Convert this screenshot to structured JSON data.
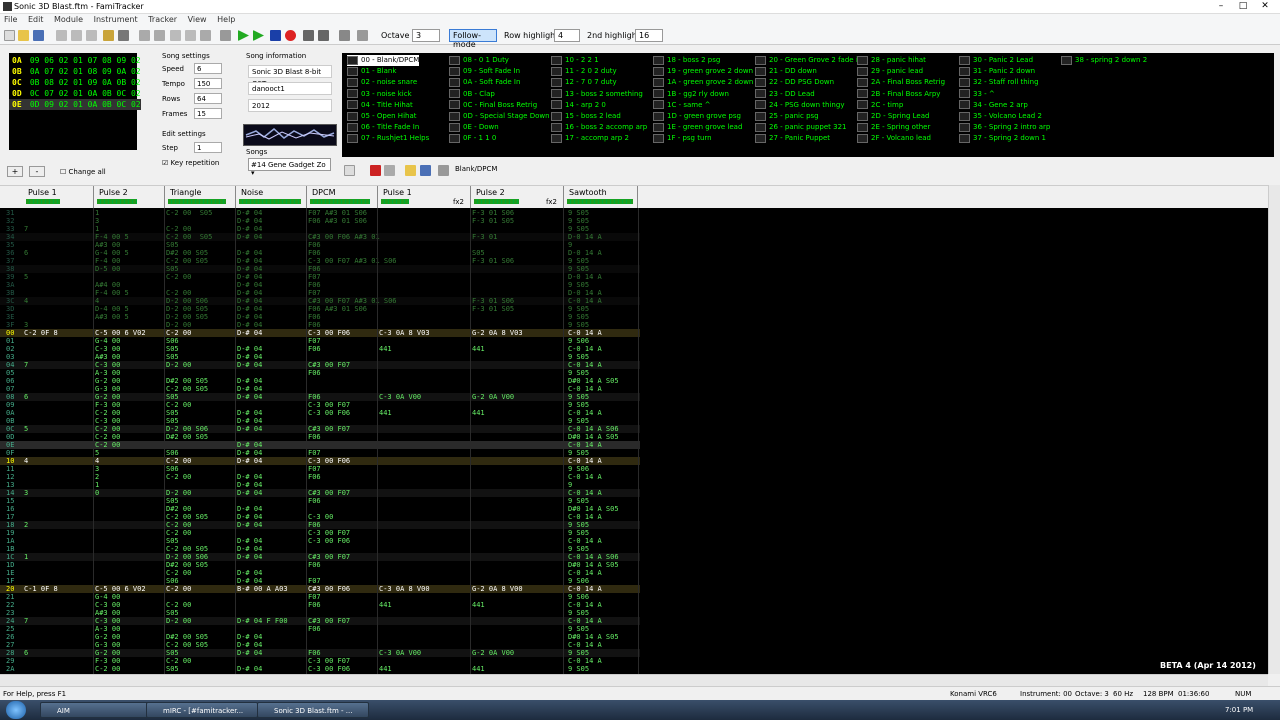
{
  "window": {
    "title": "Sonic 3D Blast.ftm - FamiTracker"
  },
  "menu": [
    "File",
    "Edit",
    "Module",
    "Instrument",
    "Tracker",
    "View",
    "Help"
  ],
  "toolbar": {
    "octave_label": "Octave",
    "octave_value": "3",
    "follow_mode": "Follow-mode",
    "row_highlight_label": "Row highlight",
    "row_highlight_value": "4",
    "second_highlight_label": "2nd highlight",
    "second_highlight_value": "16"
  },
  "frames": [
    {
      "row": "0A",
      "values": "09 06 02 01 07 08 09 02"
    },
    {
      "row": "0B",
      "values": "0A 07 02 01 08 09 0A 02"
    },
    {
      "row": "0C",
      "values": "0B 08 02 01 09 0A 0B 02"
    },
    {
      "row": "0D",
      "values": "0C 07 02 01 0A 0B 0C 02"
    },
    {
      "row": "0E",
      "values": "0D 09 02 01 0A 0B 0C 02"
    }
  ],
  "song_settings": {
    "heading": "Song settings",
    "speed_label": "Speed",
    "speed": "6",
    "tempo_label": "Tempo",
    "tempo": "150",
    "rows_label": "Rows",
    "rows": "64",
    "frames_label": "Frames",
    "frames": "15",
    "edit_heading": "Edit settings",
    "step_label": "Step",
    "step": "1",
    "key_repetition": "Key repetition"
  },
  "song_info": {
    "heading": "Song information",
    "title": "Sonic 3D Blast 8-bit OST",
    "author": "danooct1",
    "copyright": "2012",
    "songs_label": "Songs",
    "song_selected": "#14 Gene Gadget Zo"
  },
  "instruments": [
    "00 - Blank/DPCM",
    "01 - Blank",
    "02 - noise snare",
    "03 - noise kick",
    "04 - Title Hihat",
    "05 - Open Hihat",
    "06 - Title Fade In",
    "07 - Rushjet1 Helps",
    "08 - 0 1 Duty",
    "09 - Soft Fade In",
    "0A - Soft Fade In",
    "0B - Clap",
    "0C - Final Boss Retrig",
    "0D - Special Stage Down",
    "0E - Down",
    "0F - 1 1 0",
    "10 - 2 2 1",
    "11 - 2 0 2 duty",
    "12 - 7 0 7 duty",
    "13 - boss 2 something",
    "14 - arp 2 0",
    "15 - boss 2 lead",
    "16 - boss 2 accomp arp",
    "17 - accomp arp 2",
    "18 - boss 2 psg",
    "19 - green grove 2 down",
    "1A - green grove 2 down",
    "1B - gg2 rly down",
    "1C - same ^",
    "1D - green grove psg",
    "1E - green grove lead",
    "1F - psg turn",
    "20 - Green Grove 2 fade in",
    "21 - DD down",
    "22 - DD PSG Down",
    "23 - DD Lead",
    "24 - PSG down thingy",
    "25 - panic psg",
    "26 - panic puppet 321",
    "27 - Panic Puppet",
    "28 - panic hihat",
    "29 - panic lead",
    "2A - Final Boss Retrig",
    "2B - Final Boss Arpy",
    "2C - timp",
    "2D - Spring Lead",
    "2E - Spring other",
    "2F - Volcano lead",
    "30 - Panic 2 Lead",
    "31 - Panic 2 down",
    "32 - Staff roll thing",
    "33 - ^",
    "34 - Gene 2 arp",
    "35 - Volcano Lead 2",
    "36 - Spring 2 intro arp",
    "37 - Spring 2 down 1",
    "38 - spring 2 down 2"
  ],
  "instrument_name": "Blank/DPCM",
  "change_all": "Change all",
  "channels": [
    "Pulse 1",
    "Pulse 2",
    "Triangle",
    "Noise",
    "DPCM",
    "Pulse 1",
    "Pulse 2",
    "Sawtooth"
  ],
  "fx_labels": [
    "fx2",
    "fx2"
  ],
  "pattern_rows": [
    {
      "r": "31",
      "c": [
        "",
        "1",
        "C-2 00  S05",
        "D-# 04",
        "F07 A#3 01 S06",
        "",
        "F-3 01 S06",
        "9 S05"
      ]
    },
    {
      "r": "32",
      "c": [
        "",
        "3",
        "",
        "D-# 04",
        "F06 A#3 01 S06",
        "",
        "F-3 01 S05",
        "9 S05"
      ]
    },
    {
      "r": "33",
      "c": [
        "7",
        "1",
        "C-2 00",
        "D-# 04",
        "",
        "",
        "",
        "9 S05"
      ]
    },
    {
      "r": "34",
      "c": [
        "",
        "F-4 00 5",
        "C-2 00  S05",
        "D-# 04",
        "C#3 00 F06 A#3 01",
        "",
        "F-3 01",
        "D-0 14 A"
      ]
    },
    {
      "r": "35",
      "c": [
        "",
        "A#3 00",
        "S05",
        "",
        "F06",
        "",
        "",
        "9"
      ]
    },
    {
      "r": "36",
      "c": [
        "6",
        "G-4 00 5",
        "D#2 00 S05",
        "D-# 04",
        "F06",
        "",
        "S05",
        "D-0 14 A"
      ]
    },
    {
      "r": "37",
      "c": [
        "",
        "F-4 00",
        "C-2 00 S05",
        "D-# 04",
        "C-3 00 F07 A#3 01 S06",
        "",
        "F-3 01 S06",
        "9 S05"
      ]
    },
    {
      "r": "38",
      "c": [
        "",
        "D-5 00",
        "S05",
        "D-# 04",
        "F06",
        "",
        "",
        "9 S05"
      ]
    },
    {
      "r": "39",
      "c": [
        "5",
        "",
        "C-2 00",
        "D-# 04",
        "F07",
        "",
        "",
        "D-0 14 A"
      ]
    },
    {
      "r": "3A",
      "c": [
        "",
        "A#4 00",
        "",
        "D-# 04",
        "F06",
        "",
        "",
        "9 S05"
      ]
    },
    {
      "r": "3B",
      "c": [
        "",
        "F-4 00 5",
        "C-2 00",
        "D-# 04",
        "F07",
        "",
        "",
        "D-0 14 A"
      ]
    },
    {
      "r": "3C",
      "c": [
        "4",
        "4",
        "D-2 00 S06",
        "D-# 04",
        "C#3 00 F07 A#3 01 S06",
        "",
        "F-3 01 S06",
        "C-0 14 A"
      ]
    },
    {
      "r": "3D",
      "c": [
        "",
        "D-4 00 5",
        "D-2 00 S05",
        "D-# 04",
        "F06 A#3 01 S06",
        "",
        "F-3 01 S05",
        "9 S05"
      ]
    },
    {
      "r": "3E",
      "c": [
        "",
        "A#3 00 5",
        "D-2 00 S05",
        "D-# 04",
        "F06",
        "",
        "",
        "9 S05"
      ]
    },
    {
      "r": "3F",
      "c": [
        "3",
        "",
        "D-2 00",
        "D-# 04",
        "F06",
        "",
        "",
        "9 S05"
      ]
    },
    {
      "r": "00",
      "c": [
        "C-2 0F 8",
        "C-5 00 6 V02",
        "C-2 00",
        "D-# 04",
        "C-3 00 F06",
        "C-3 0A 8 V03",
        "G-2 0A 8 V03",
        "C-0 14 A"
      ]
    },
    {
      "r": "01",
      "c": [
        "",
        "G-4 00",
        "S06",
        "",
        "F07",
        "",
        "",
        "9 S06"
      ]
    },
    {
      "r": "02",
      "c": [
        "",
        "C-3 00",
        "S05",
        "D-# 04",
        "F06",
        "441",
        "441",
        "C-0 14 A"
      ]
    },
    {
      "r": "03",
      "c": [
        "",
        "A#3 00",
        "S05",
        "D-# 04",
        "",
        "",
        "",
        "9 S05"
      ]
    },
    {
      "r": "04",
      "c": [
        "7",
        "C-3 00",
        "D-2 00",
        "D-# 04",
        "C#3 00 F07",
        "",
        "",
        "C-0 14 A"
      ]
    },
    {
      "r": "05",
      "c": [
        "",
        "A-3 00",
        "",
        "",
        "F06",
        "",
        "",
        "9 S05"
      ]
    },
    {
      "r": "06",
      "c": [
        "",
        "G-2 00",
        "D#2 00 S05",
        "D-# 04",
        "",
        "",
        "",
        "D#0 14 A S05"
      ]
    },
    {
      "r": "07",
      "c": [
        "",
        "G-3 00",
        "C-2 00 S05",
        "D-# 04",
        "",
        "",
        "",
        "C-0 14 A"
      ]
    },
    {
      "r": "08",
      "c": [
        "6",
        "G-2 00",
        "S05",
        "D-# 04",
        "F06",
        "C-3 0A V00",
        "G-2 0A V00",
        "9 S05"
      ]
    },
    {
      "r": "09",
      "c": [
        "",
        "F-3 00",
        "C-2 00",
        "",
        "C-3 00 F07",
        "",
        "",
        "9 S05"
      ]
    },
    {
      "r": "0A",
      "c": [
        "",
        "C-2 00",
        "S05",
        "D-# 04",
        "C-3 00 F06",
        "441",
        "441",
        "C-0 14 A"
      ]
    },
    {
      "r": "0B",
      "c": [
        "",
        "C-3 00",
        "S05",
        "D-# 04",
        "",
        "",
        "",
        "9 S05"
      ]
    },
    {
      "r": "0C",
      "c": [
        "5",
        "C-2 00",
        "D-2 00 S06",
        "D-# 04",
        "C#3 00 F07",
        "",
        "",
        "C-0 14 A S06"
      ]
    },
    {
      "r": "0D",
      "c": [
        "",
        "C-2 00",
        "D#2 00 S05",
        "",
        "F06",
        "",
        "",
        "D#0 14 A S05"
      ]
    },
    {
      "r": "0E",
      "c": [
        "",
        "C-2 00",
        "",
        "D-# 04",
        "",
        "",
        "",
        "C-0 14 A"
      ]
    },
    {
      "r": "0F",
      "c": [
        "",
        "5",
        "S06",
        "D-# 04",
        "F07",
        "",
        "",
        "9 S05"
      ]
    },
    {
      "r": "10",
      "c": [
        "4",
        "4",
        "C-2 00",
        "D-# 04",
        "C-3 00 F06",
        "",
        "",
        "C-0 14 A"
      ]
    },
    {
      "r": "11",
      "c": [
        "",
        "3",
        "S06",
        "",
        "F07",
        "",
        "",
        "9 S06"
      ]
    },
    {
      "r": "12",
      "c": [
        "",
        "2",
        "C-2 00",
        "D-# 04",
        "F06",
        "",
        "",
        "C-0 14 A"
      ]
    },
    {
      "r": "13",
      "c": [
        "",
        "1",
        "",
        "D-# 04",
        "",
        "",
        "",
        "9"
      ]
    },
    {
      "r": "14",
      "c": [
        "3",
        "0",
        "D-2 00",
        "D-# 04",
        "C#3 00 F07",
        "",
        "",
        "C-0 14 A"
      ]
    },
    {
      "r": "15",
      "c": [
        "",
        "",
        "S05",
        "",
        "F06",
        "",
        "",
        "9 S05"
      ]
    },
    {
      "r": "16",
      "c": [
        "",
        "",
        "D#2 00",
        "D-# 04",
        "",
        "",
        "",
        "D#0 14 A S05"
      ]
    },
    {
      "r": "17",
      "c": [
        "",
        "",
        "C-2 00 S05",
        "D-# 04",
        "C-3 00",
        "",
        "",
        "C-0 14 A"
      ]
    },
    {
      "r": "18",
      "c": [
        "2",
        "",
        "C-2 00",
        "D-# 04",
        "F06",
        "",
        "",
        "9 S05"
      ]
    },
    {
      "r": "19",
      "c": [
        "",
        "",
        "C-2 00",
        "",
        "C-3 00 F07",
        "",
        "",
        "9 S05"
      ]
    },
    {
      "r": "1A",
      "c": [
        "",
        "",
        "S05",
        "D-# 04",
        "C-3 00 F06",
        "",
        "",
        "C-0 14 A"
      ]
    },
    {
      "r": "1B",
      "c": [
        "",
        "",
        "C-2 00 S05",
        "D-# 04",
        "",
        "",
        "",
        "9 S05"
      ]
    },
    {
      "r": "1C",
      "c": [
        "1",
        "",
        "D-2 00 S06",
        "D-# 04",
        "C#3 00 F07",
        "",
        "",
        "C-0 14 A S06"
      ]
    },
    {
      "r": "1D",
      "c": [
        "",
        "",
        "D#2 00 S05",
        "",
        "F06",
        "",
        "",
        "D#0 14 A S05"
      ]
    },
    {
      "r": "1E",
      "c": [
        "",
        "",
        "C-2 00",
        "D-# 04",
        "",
        "",
        "",
        "C-0 14 A"
      ]
    },
    {
      "r": "1F",
      "c": [
        "",
        "",
        "S06",
        "D-# 04",
        "F07",
        "",
        "",
        "9 S06"
      ]
    },
    {
      "r": "20",
      "c": [
        "C-1 0F 8",
        "C-5 00 6 V02",
        "C-2 00",
        "B-# 00 A A03",
        "C#3 00 F06",
        "C-3 0A 8 V00",
        "G-2 0A 8 V00",
        "C-0 14 A"
      ]
    },
    {
      "r": "21",
      "c": [
        "",
        "G-4 00",
        "",
        "",
        "F07",
        "",
        "",
        "9 S06"
      ]
    },
    {
      "r": "22",
      "c": [
        "",
        "C-3 00",
        "C-2 00",
        "",
        "F06",
        "441",
        "441",
        "C-0 14 A"
      ]
    },
    {
      "r": "23",
      "c": [
        "",
        "A#3 00",
        "S05",
        "",
        "",
        "",
        "",
        "9 S05"
      ]
    },
    {
      "r": "24",
      "c": [
        "7",
        "C-3 00",
        "D-2 00",
        "D-# 04 F F00",
        "C#3 00 F07",
        "",
        "",
        "C-0 14 A"
      ]
    },
    {
      "r": "25",
      "c": [
        "",
        "A-3 00",
        "",
        "",
        "F06",
        "",
        "",
        "9 S05"
      ]
    },
    {
      "r": "26",
      "c": [
        "",
        "G-2 00",
        "D#2 00 S05",
        "D-# 04",
        "",
        "",
        "",
        "D#0 14 A S05"
      ]
    },
    {
      "r": "27",
      "c": [
        "",
        "G-3 00",
        "C-2 00 S05",
        "D-# 04",
        "",
        "",
        "",
        "C-0 14 A"
      ]
    },
    {
      "r": "28",
      "c": [
        "6",
        "G-2 00",
        "S05",
        "D-# 04",
        "F06",
        "C-3 0A V00",
        "G-2 0A V00",
        "9 S05"
      ]
    },
    {
      "r": "29",
      "c": [
        "",
        "F-3 00",
        "C-2 00",
        "",
        "C-3 00 F07",
        "",
        "",
        "C-0 14 A"
      ]
    },
    {
      "r": "2A",
      "c": [
        "",
        "C-2 00",
        "S05",
        "D-# 04",
        "C-3 00 F06",
        "441",
        "441",
        "9 S05"
      ]
    }
  ],
  "beta": "BETA 4 (Apr 14 2012)",
  "status": {
    "help": "For Help, press F1",
    "chip": "Konami VRC6",
    "instrument": "Instrument: 00",
    "octave": "Octave: 3",
    "rate": "60 Hz",
    "bpm": "128 BPM",
    "time": "01:36:60",
    "num": "NUM"
  },
  "taskbar": {
    "items": [
      "AIM",
      "mIRC - [#famitracker...",
      "Sonic 3D Blast.ftm - ..."
    ],
    "clock": "7:01 PM"
  }
}
